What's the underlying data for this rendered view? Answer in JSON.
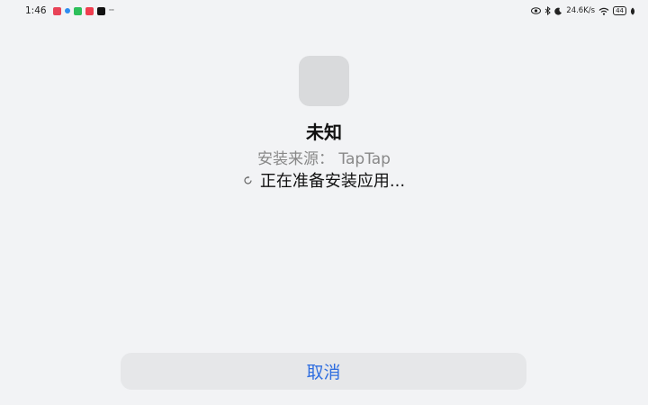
{
  "status_bar": {
    "time": "1:46",
    "more": "···",
    "net_speed": "24.6K/s",
    "battery": "44",
    "notification_icons": [
      "red-app-icon",
      "blue-dot-icon",
      "green-chat-icon",
      "red-app-icon",
      "tiktok-icon"
    ],
    "system_icons": [
      "eye-icon",
      "bluetooth-icon",
      "moon-icon",
      "wifi-icon",
      "battery-icon",
      "leaf-icon"
    ]
  },
  "app": {
    "name": "未知",
    "install_source": "安装来源： TapTap",
    "progress_text": "正在准备安装应用...",
    "icon_color": "#d9dadc"
  },
  "actions": {
    "cancel_label": "取消",
    "accent_color": "#2f6ee0"
  }
}
